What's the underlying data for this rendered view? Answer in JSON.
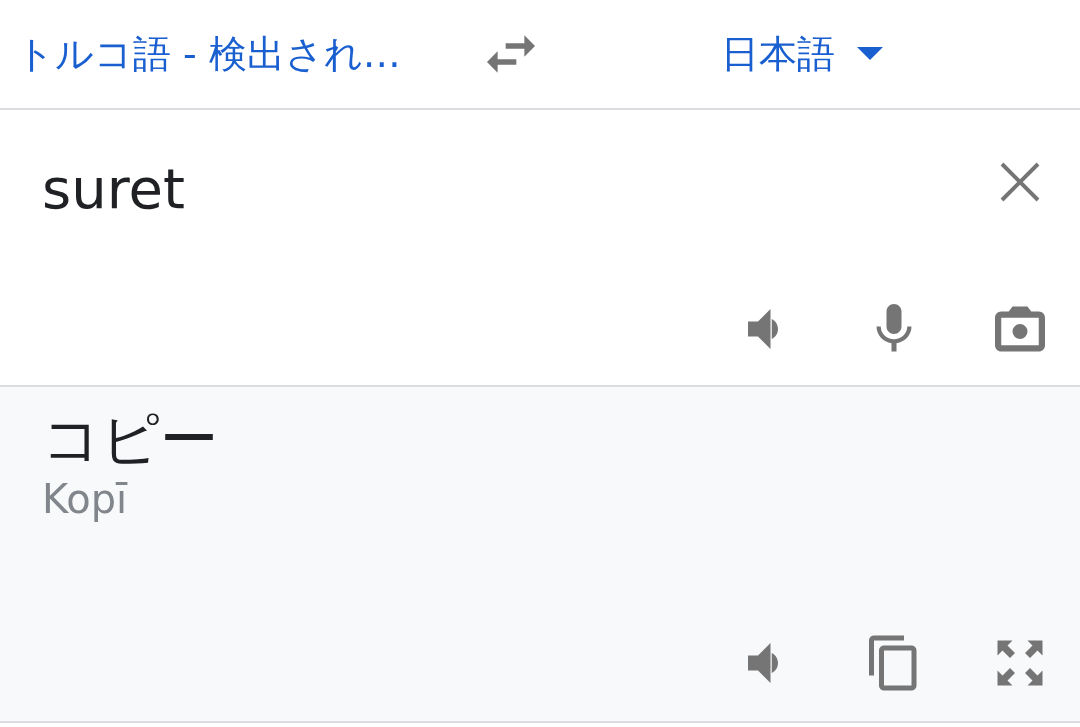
{
  "language_bar": {
    "source": {
      "label": "トルコ語 - 検出され…"
    },
    "target": {
      "label": "日本語"
    }
  },
  "input": {
    "value": "suret"
  },
  "translation": {
    "text": "コピー",
    "romanization": "Kopī"
  }
}
